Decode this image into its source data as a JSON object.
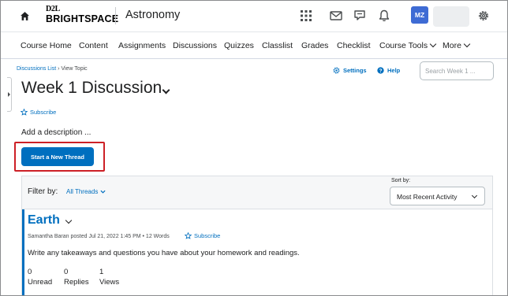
{
  "header": {
    "logo_top": "D2L",
    "logo_bottom": "BRIGHTSPACE",
    "course_title": "Astronomy",
    "avatar_initials": "MZ",
    "icons": [
      "home-icon",
      "grid-icon",
      "mail-icon",
      "chat-icon",
      "bell-icon",
      "gear-icon"
    ]
  },
  "nav": {
    "items": [
      "Course Home",
      "Content",
      "Assignments",
      "Discussions",
      "Quizzes",
      "Classlist",
      "Grades",
      "Checklist",
      "Course Tools",
      "More"
    ]
  },
  "breadcrumb": {
    "parent": "Discussions List",
    "separator": "›",
    "current": "View Topic"
  },
  "toolbar": {
    "settings": "Settings",
    "help": "Help",
    "search_placeholder": "Search Week 1 ..."
  },
  "topic": {
    "title": "Week 1 Discussion",
    "subscribe": "Subscribe",
    "description_placeholder": "Add a description ...",
    "start_thread": "Start a New Thread"
  },
  "filters": {
    "filter_label": "Filter by:",
    "filter_value": "All Threads",
    "sort_label": "Sort by:",
    "sort_value": "Most Recent Activity"
  },
  "thread": {
    "title": "Earth",
    "meta": "Samantha Baran posted Jul 21, 2022 1:45 PM • 12 Words",
    "subscribe": "Subscribe",
    "body": "Write any takeaways and questions you have about your homework and readings.",
    "unread_count": "0",
    "unread_label": "Unread",
    "replies_count": "0",
    "replies_label": "Replies",
    "views_count": "1",
    "views_label": "Views"
  },
  "colors": {
    "link": "#006fbf",
    "primary": "#006fbf",
    "highlight": "#cd2026",
    "avatar": "#3e6bd4"
  }
}
